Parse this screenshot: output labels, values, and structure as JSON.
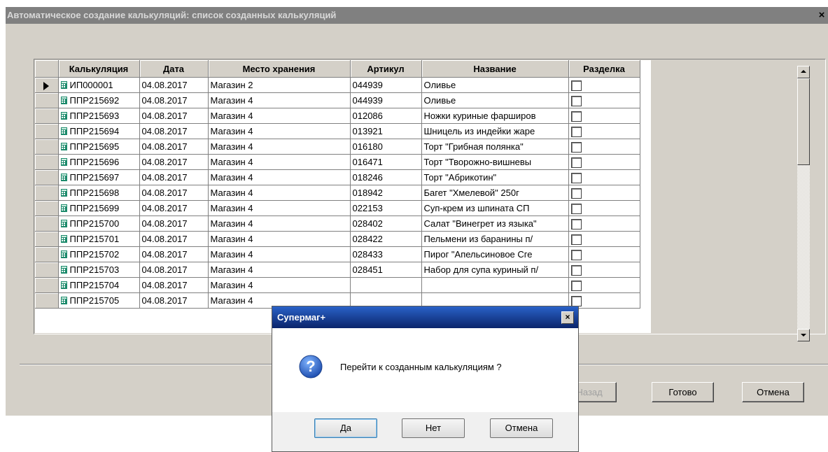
{
  "window": {
    "title": "Автоматическое создание калькуляций: список созданных калькуляций",
    "close_label": "×"
  },
  "grid": {
    "columns": [
      "Калькуляция",
      "Дата",
      "Место хранения",
      "Артикул",
      "Название",
      "Разделка"
    ],
    "rows": [
      {
        "calc": "ИП000001",
        "date": "04.08.2017",
        "store": "Магазин 2",
        "art": "044939",
        "name": "Оливье",
        "cut": false
      },
      {
        "calc": "ППР215692",
        "date": "04.08.2017",
        "store": "Магазин 4",
        "art": "044939",
        "name": "Оливье",
        "cut": false
      },
      {
        "calc": "ППР215693",
        "date": "04.08.2017",
        "store": "Магазин 4",
        "art": "012086",
        "name": "Ножки куриные фарширов",
        "cut": false
      },
      {
        "calc": "ППР215694",
        "date": "04.08.2017",
        "store": "Магазин 4",
        "art": "013921",
        "name": "Шницель из индейки жаре",
        "cut": false
      },
      {
        "calc": "ППР215695",
        "date": "04.08.2017",
        "store": "Магазин 4",
        "art": "016180",
        "name": "Торт \"Грибная полянка\"",
        "cut": false
      },
      {
        "calc": "ППР215696",
        "date": "04.08.2017",
        "store": "Магазин 4",
        "art": "016471",
        "name": "Торт \"Творожно-вишневы",
        "cut": false
      },
      {
        "calc": "ППР215697",
        "date": "04.08.2017",
        "store": "Магазин 4",
        "art": "018246",
        "name": "Торт \"Абрикотин\"",
        "cut": false
      },
      {
        "calc": "ППР215698",
        "date": "04.08.2017",
        "store": "Магазин 4",
        "art": "018942",
        "name": "Багет \"Хмелевой\" 250г",
        "cut": false
      },
      {
        "calc": "ППР215699",
        "date": "04.08.2017",
        "store": "Магазин 4",
        "art": "022153",
        "name": "Суп-крем из шпината СП",
        "cut": false
      },
      {
        "calc": "ППР215700",
        "date": "04.08.2017",
        "store": "Магазин 4",
        "art": "028402",
        "name": "Салат \"Винегрет из языка\"",
        "cut": false
      },
      {
        "calc": "ППР215701",
        "date": "04.08.2017",
        "store": "Магазин 4",
        "art": "028422",
        "name": "Пельмени из баранины п/",
        "cut": false
      },
      {
        "calc": "ППР215702",
        "date": "04.08.2017",
        "store": "Магазин 4",
        "art": "028433",
        "name": "Пирог \"Апельсиновое Сге",
        "cut": false
      },
      {
        "calc": "ППР215703",
        "date": "04.08.2017",
        "store": "Магазин 4",
        "art": "028451",
        "name": "Набор для супа куриный п/",
        "cut": false
      },
      {
        "calc": "ППР215704",
        "date": "04.08.2017",
        "store": "Магазин 4",
        "art": "",
        "name": "",
        "cut": false
      },
      {
        "calc": "ППР215705",
        "date": "04.08.2017",
        "store": "Магазин 4",
        "art": "",
        "name": "",
        "cut": false
      }
    ],
    "current_row": 0
  },
  "buttons": {
    "back": "< Назад",
    "finish": "Готово",
    "cancel": "Отмена"
  },
  "dialog": {
    "title": "Супермаг+",
    "close_label": "×",
    "message": "Перейти к созданным калькуляциям ?",
    "icon": "question-icon",
    "yes": "Да",
    "no": "Нет",
    "cancel": "Отмена"
  },
  "colors": {
    "dialog_title": "#0a246a",
    "window_title": "#808080",
    "question_icon": "#1f5fbf"
  }
}
